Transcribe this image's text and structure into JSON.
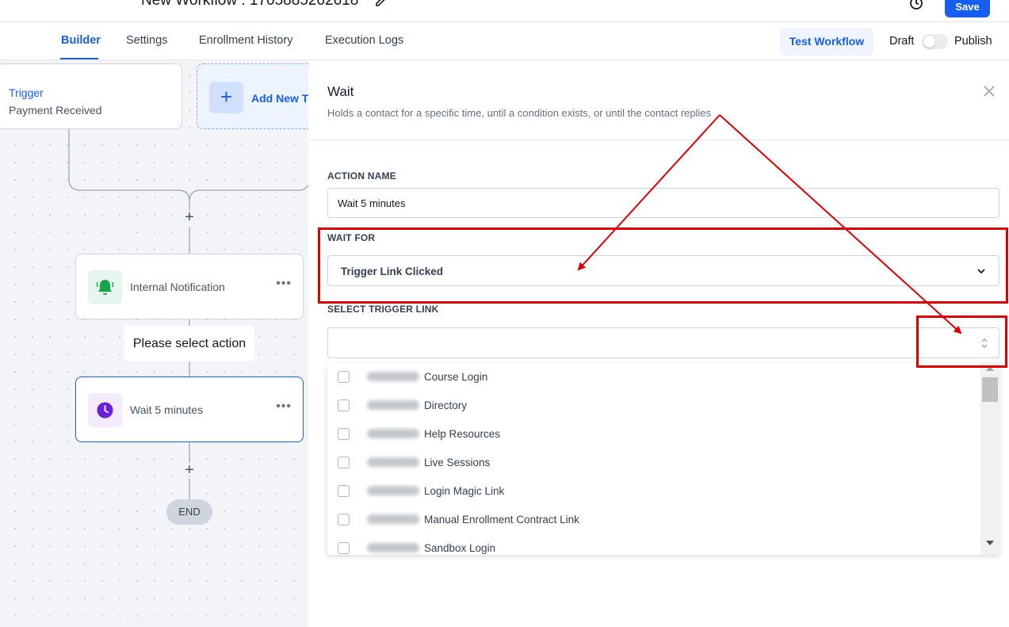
{
  "header": {
    "workflow_title": "New Workflow : 1705885262618",
    "save_label": "Save"
  },
  "tabs": [
    {
      "label": "Builder",
      "active": true
    },
    {
      "label": "Settings",
      "active": false
    },
    {
      "label": "Enrollment History",
      "active": false
    },
    {
      "label": "Execution Logs",
      "active": false
    }
  ],
  "toolbar": {
    "test_label": "Test Workflow",
    "draft_label": "Draft",
    "publish_label": "Publish",
    "publish_toggle_on": false
  },
  "canvas": {
    "trigger": {
      "title": "Trigger",
      "subtitle": "Payment Received"
    },
    "add_trigger_label": "Add New Trigger",
    "nodes": [
      {
        "label": "Internal Notification",
        "icon": "bell-icon",
        "icon_bg": "#e6f6ee",
        "icon_color": "#16a34a"
      },
      {
        "label": "Wait 5 minutes",
        "icon": "clock-icon",
        "icon_bg": "#f4ebff",
        "icon_color": "#6b21d8",
        "selected": true
      }
    ],
    "select_action_label": "Please select action",
    "end_label": "END"
  },
  "panel": {
    "title": "Wait",
    "description": "Holds a contact for a specific time, until a condition exists, or until the contact replies",
    "action_name_label": "ACTION NAME",
    "action_name_value": "Wait 5 minutes",
    "wait_for_label": "WAIT FOR",
    "wait_for_value": "Trigger Link Clicked",
    "select_trigger_link_label": "SELECT TRIGGER LINK",
    "select_trigger_link_value": "",
    "options": [
      {
        "label": "Course Login",
        "checked": false
      },
      {
        "label": "Directory",
        "checked": false
      },
      {
        "label": "Help Resources",
        "checked": false
      },
      {
        "label": "Live Sessions",
        "checked": false
      },
      {
        "label": "Login Magic Link",
        "checked": false
      },
      {
        "label": "Manual Enrollment Contract Link",
        "checked": false
      },
      {
        "label": "Sandbox Login",
        "checked": false
      }
    ]
  },
  "colors": {
    "accent": "#155eef",
    "annotation": "#e00000"
  }
}
